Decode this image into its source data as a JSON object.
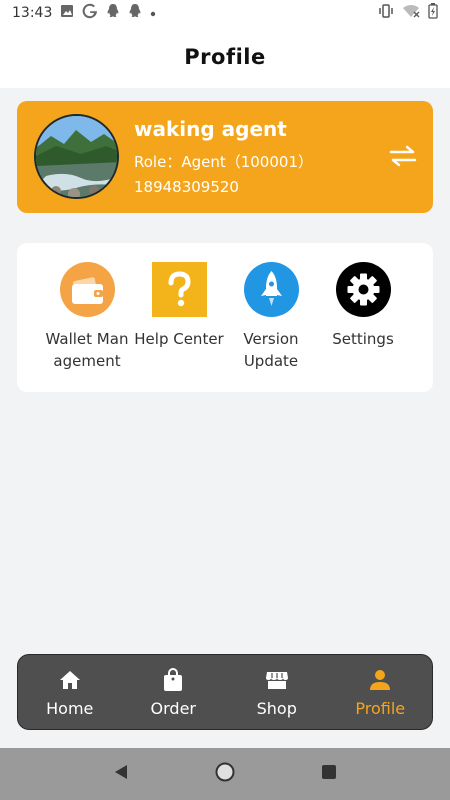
{
  "status_bar": {
    "time": "13:43",
    "icons_left": [
      "image-icon",
      "google-icon",
      "qq-icon",
      "qq-icon",
      "dot-icon"
    ],
    "icons_right": [
      "vibrate-icon",
      "wifi-icon",
      "battery-icon"
    ]
  },
  "header": {
    "title": "Profile"
  },
  "profile": {
    "name": "waking agent",
    "role": "Role：Agent（100001）",
    "phone": "18948309520",
    "avatar_icon": "landscape-avatar",
    "switch_icon": "swap-icon"
  },
  "menu": [
    {
      "label": "Wallet Man agement",
      "icon": "wallet-icon",
      "color": "#f4a345"
    },
    {
      "label": "Help Center",
      "icon": "question-icon",
      "color": "#f3b41b"
    },
    {
      "label": "Version Update",
      "icon": "rocket-icon",
      "color": "#2196e3"
    },
    {
      "label": "Settings",
      "icon": "gear-icon",
      "color": "#000000"
    }
  ],
  "bottom_nav": [
    {
      "label": "Home",
      "icon": "home-icon"
    },
    {
      "label": "Order",
      "icon": "bag-icon"
    },
    {
      "label": "Shop",
      "icon": "shop-icon"
    },
    {
      "label": "Profile",
      "icon": "person-icon"
    }
  ],
  "colors": {
    "accent": "#f4a51c",
    "nav_background": "#4f4f4f",
    "page_background": "#f2f3f5"
  },
  "system_nav": [
    "back-icon",
    "home-circle-icon",
    "recents-icon"
  ]
}
